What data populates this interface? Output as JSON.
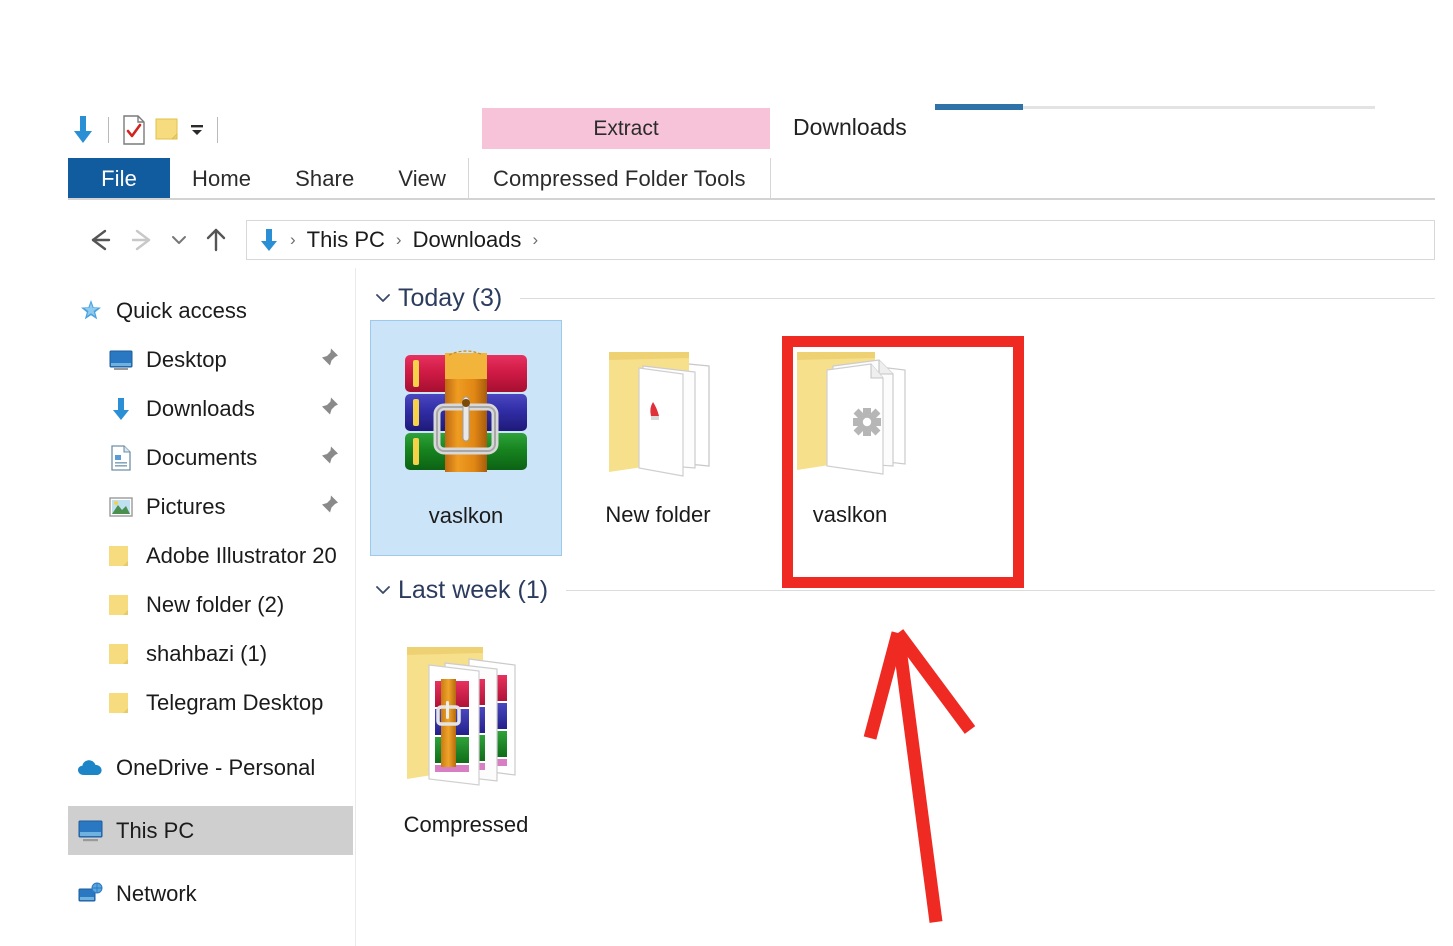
{
  "window": {
    "title": "Downloads",
    "accent_color": "#2f72a8"
  },
  "quick_access_toolbar": {
    "items": [
      {
        "icon": "downloads-arrow-icon",
        "name": "downloads"
      },
      {
        "icon": "properties-icon",
        "name": "properties"
      },
      {
        "icon": "new-folder-icon",
        "name": "new-folder"
      },
      {
        "icon": "chevron-down-icon",
        "name": "customize"
      }
    ]
  },
  "ribbon": {
    "contextual_header": "Extract",
    "contextual_color": "#f7c3d8",
    "tabs": [
      {
        "label": "File",
        "active": true
      },
      {
        "label": "Home",
        "active": false
      },
      {
        "label": "Share",
        "active": false
      },
      {
        "label": "View",
        "active": false
      },
      {
        "label": "Compressed Folder Tools",
        "active": false,
        "contextual": true
      }
    ]
  },
  "navbar": {
    "back": "back-arrow",
    "forward": "forward-arrow",
    "recent": "chevron-down",
    "up": "up-arrow",
    "breadcrumbs": [
      {
        "label": "",
        "icon": "downloads-arrow-icon"
      },
      {
        "label": "This PC",
        "icon": ""
      },
      {
        "label": "Downloads",
        "icon": ""
      }
    ],
    "separator": "›"
  },
  "sidebar": {
    "items": [
      {
        "label": "Quick access",
        "icon": "star-pin-icon",
        "level": "root",
        "pinned": false,
        "selected": false
      },
      {
        "label": "Desktop",
        "icon": "desktop-icon",
        "level": "child",
        "pinned": true,
        "selected": false
      },
      {
        "label": "Downloads",
        "icon": "downloads-arrow-icon",
        "level": "child",
        "pinned": true,
        "selected": false
      },
      {
        "label": "Documents",
        "icon": "documents-icon",
        "level": "child",
        "pinned": true,
        "selected": false
      },
      {
        "label": "Pictures",
        "icon": "pictures-icon",
        "level": "child",
        "pinned": true,
        "selected": false
      },
      {
        "label": "Adobe Illustrator 20",
        "icon": "folder-icon",
        "level": "child",
        "pinned": false,
        "selected": false
      },
      {
        "label": "New folder (2)",
        "icon": "folder-icon",
        "level": "child",
        "pinned": false,
        "selected": false
      },
      {
        "label": "shahbazi (1)",
        "icon": "folder-icon",
        "level": "child",
        "pinned": false,
        "selected": false
      },
      {
        "label": "Telegram Desktop",
        "icon": "folder-icon",
        "level": "child",
        "pinned": false,
        "selected": false
      },
      {
        "label": "OneDrive - Personal",
        "icon": "onedrive-cloud-icon",
        "level": "root",
        "pinned": false,
        "selected": false
      },
      {
        "label": "This PC",
        "icon": "this-pc-icon",
        "level": "root",
        "pinned": false,
        "selected": true
      },
      {
        "label": "Network",
        "icon": "network-icon",
        "level": "root",
        "pinned": false,
        "selected": false
      }
    ]
  },
  "content": {
    "groups": [
      {
        "title": "Today (3)",
        "count": 3,
        "expanded": true,
        "items": [
          {
            "label": "vaslkon",
            "icon": "winrar-archive-icon",
            "selected": true,
            "highlighted": false
          },
          {
            "label": "New folder",
            "icon": "open-folder-icon",
            "selected": false,
            "highlighted": false
          },
          {
            "label": "vaslkon",
            "icon": "open-folder-multi-icon",
            "selected": false,
            "highlighted": true
          }
        ]
      },
      {
        "title": "Last week (1)",
        "count": 1,
        "expanded": true,
        "items": [
          {
            "label": "Compressed",
            "icon": "folder-with-archive-thumbnail-icon",
            "selected": false,
            "highlighted": false
          }
        ]
      }
    ]
  },
  "annotations": {
    "highlight_color": "#ee2a22",
    "box_target": "vaslkon",
    "arrow": "points-up-at-highlighted-folder"
  }
}
